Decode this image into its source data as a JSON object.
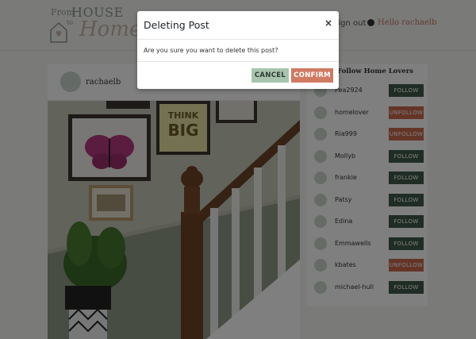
{
  "header": {
    "logo": {
      "from": "From",
      "house": "HOUSE",
      "to": "to",
      "home": "Home"
    },
    "signout_label": "Sign out",
    "user_label": "Hello rachaelb"
  },
  "post": {
    "username": "rachaelb",
    "art_text_top": "THINK",
    "art_text_bottom": "BIG"
  },
  "sidebar": {
    "title": "Follow Home Lovers",
    "users": [
      {
        "name": "Pea2924",
        "button": "FOLLOW",
        "state": "follow"
      },
      {
        "name": "homelover",
        "button": "UNFOLLOW",
        "state": "unfollow"
      },
      {
        "name": "Ria999",
        "button": "UNFOLLOW",
        "state": "unfollow"
      },
      {
        "name": "Mollyb",
        "button": "FOLLOW",
        "state": "follow"
      },
      {
        "name": "frankie",
        "button": "FOLLOW",
        "state": "follow"
      },
      {
        "name": "Patsy",
        "button": "FOLLOW",
        "state": "follow"
      },
      {
        "name": "Edina",
        "button": "FOLLOW",
        "state": "follow"
      },
      {
        "name": "Emmawells",
        "button": "FOLLOW",
        "state": "follow"
      },
      {
        "name": "kbates",
        "button": "UNFOLLOW",
        "state": "unfollow"
      },
      {
        "name": "michael-hull",
        "button": "FOLLOW",
        "state": "follow"
      }
    ]
  },
  "modal": {
    "title": "Deleting Post",
    "close": "×",
    "body": "Are you sure you want to delete this post?",
    "cancel_label": "CANCEL",
    "confirm_label": "CONFIRM"
  },
  "colors": {
    "follow": "#3e5a48",
    "unfollow": "#c86a4e",
    "cancel": "#a8c4ae",
    "confirm": "#d07a62",
    "accent": "#c47a60"
  },
  "icons": {
    "logo": "house-heart-icon",
    "user": "user-circle-icon",
    "close": "close-icon"
  }
}
